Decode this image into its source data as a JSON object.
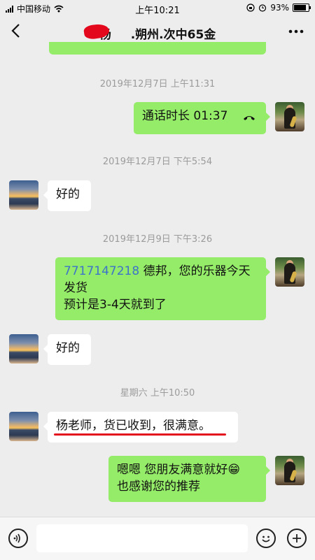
{
  "status_bar": {
    "carrier": "中国移动",
    "time": "上午10:21",
    "battery": "93%",
    "battery_level": 0.93
  },
  "header": {
    "title": "杨",
    "title_rest": ".朔州.次中65金"
  },
  "messages": [
    {
      "type": "time",
      "text": "2019年12月7日 上午11:31"
    },
    {
      "type": "out",
      "text": "通话时长 01:37"
    },
    {
      "type": "time",
      "text": "2019年12月7日 下午5:54"
    },
    {
      "type": "in",
      "text": "好的"
    },
    {
      "type": "time",
      "text": "2019年12月9日 下午3:26"
    },
    {
      "type": "out",
      "link": "7717147218",
      "line1": " 德邦，您的乐器今天",
      "line2": "发货",
      "line3": "预计是3-4天就到了"
    },
    {
      "type": "in",
      "text": "好的"
    },
    {
      "type": "time",
      "text": "星期六 上午10:50"
    },
    {
      "type": "in",
      "text": "杨老师，货已收到，很满意。"
    },
    {
      "type": "out",
      "line1": "嗯嗯 您朋友满意就好",
      "emoji": "😁",
      "line2": "也感谢您的推荐"
    }
  ],
  "colors": {
    "bubble_out": "#95ec69",
    "bubble_in": "#ffffff",
    "background": "#ededed",
    "link": "#3d74c9",
    "annotation": "#e3121d"
  },
  "icons": [
    "back-icon",
    "more-icon",
    "voice-icon",
    "emoji-icon",
    "plus-icon",
    "phone-icon"
  ]
}
